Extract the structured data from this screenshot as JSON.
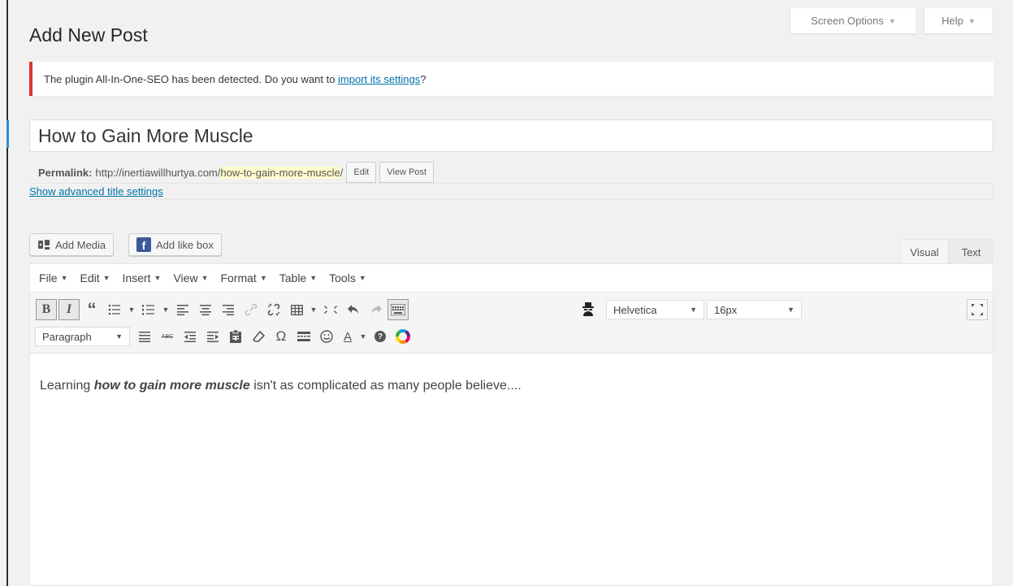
{
  "screen_meta": {
    "screen_options_label": "Screen Options",
    "help_label": "Help"
  },
  "page": {
    "title": "Add New Post"
  },
  "notice": {
    "text_before": "The plugin All-In-One-SEO has been detected. Do you want to ",
    "link_text": "import its settings",
    "text_after": "?"
  },
  "post": {
    "title": "How to Gain More Muscle",
    "permalink_label": "Permalink:",
    "permalink_base": "http://inertiawillhurtya.com/",
    "permalink_slug": "how-to-gain-more-muscle",
    "permalink_trailing": "/",
    "edit_button": "Edit",
    "view_post_button": "View Post",
    "advanced_title_link": "Show advanced title settings"
  },
  "media_buttons": {
    "add_media": "Add Media",
    "add_like_box": "Add like box"
  },
  "editor_tabs": {
    "visual": "Visual",
    "text": "Text"
  },
  "menubar": [
    "File",
    "Edit",
    "Insert",
    "View",
    "Format",
    "Table",
    "Tools"
  ],
  "toolbar": {
    "font_family": "Helvetica",
    "font_size": "16px",
    "block_format": "Paragraph"
  },
  "content": {
    "before": "Learning ",
    "emphasis": "how to gain more muscle",
    "after": " isn't as complicated as many people believe...."
  },
  "icons": {
    "bold": "B",
    "italic": "I",
    "blockquote": "“",
    "omega": "Ω",
    "help": "?",
    "text_color": "A",
    "strike": "ABC"
  },
  "colors": {
    "notice_error": "#dc3232",
    "link": "#0073aa",
    "slug_highlight": "#fffbcc",
    "facebook": "#3b5998"
  }
}
